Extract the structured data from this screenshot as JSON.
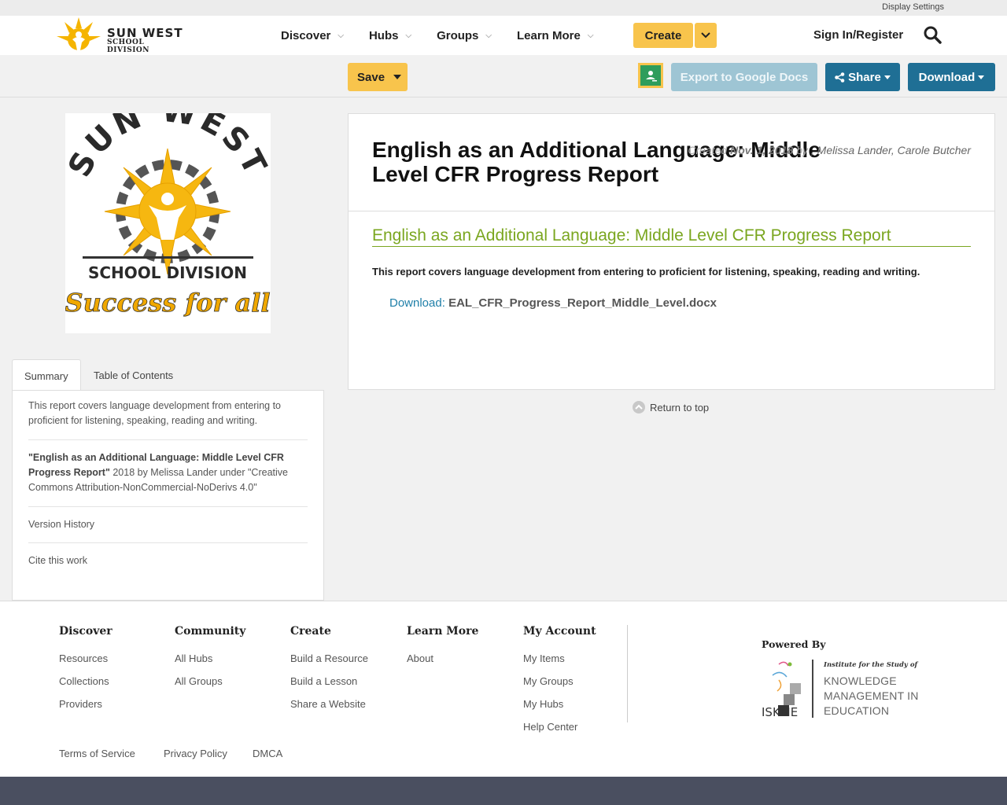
{
  "topbar": {
    "display_settings": "Display Settings"
  },
  "logo": {
    "line1": "SUN WEST",
    "line2": "SCHOOL DIVISION"
  },
  "nav": {
    "items": [
      {
        "label": "Discover"
      },
      {
        "label": "Hubs"
      },
      {
        "label": "Groups"
      },
      {
        "label": "Learn More"
      }
    ],
    "create_label": "Create",
    "signin_label": "Sign In/Register"
  },
  "toolbar": {
    "save_label": "Save",
    "export_label": "Export to Google Docs",
    "share_label": "Share",
    "download_label": "Download"
  },
  "cover": {
    "arc_text": "SUN WEST",
    "division": "SCHOOL DIVISION",
    "motto": "Success for all"
  },
  "tabs": {
    "summary": "Summary",
    "toc": "Table of Contents"
  },
  "summary": {
    "text": "This report covers language development from entering to proficient for listening, speaking, reading and writing.",
    "attribution_title": "\"English as an Additional Language: Middle Level CFR Progress Report\"",
    "attribution_mid": " 2018 by Melissa Lander under ",
    "license": "\"Creative Commons Attribution-NonCommercial-NoDerivs 4.0\"",
    "version_history": "Version History",
    "cite": "Cite this work"
  },
  "resource": {
    "title": "English as an Additional Language: Middle Level CFR Progress Report",
    "meta_created": "Created ",
    "meta_date": "Nov. 1, 2018",
    "meta_by": " by , ",
    "meta_authors": "Melissa Lander, Carole Butcher",
    "link_title": "English as an Additional Language: Middle Level CFR Progress Report",
    "description": "This report covers language development from entering to proficient for listening, speaking, reading and writing.",
    "download_label": "Download:",
    "download_file": "EAL_CFR_Progress_Report_Middle_Level.docx",
    "return_top": "Return to top"
  },
  "footer": {
    "columns": [
      {
        "heading": "Discover",
        "links": [
          "Resources",
          "Collections",
          "Providers"
        ]
      },
      {
        "heading": "Community",
        "links": [
          "All Hubs",
          "All Groups"
        ]
      },
      {
        "heading": "Create",
        "links": [
          "Build a Resource",
          "Build a Lesson",
          "Share a Website"
        ]
      },
      {
        "heading": "Learn More",
        "links": [
          "About"
        ]
      },
      {
        "heading": "My Account",
        "links": [
          "My Items",
          "My Groups",
          "My Hubs",
          "Help Center"
        ]
      }
    ],
    "powered_by": "Powered By",
    "iskme_inst": "Institute for the Study of",
    "iskme_km1": "KNOWLEDGE",
    "iskme_km2": "MANAGEMENT IN",
    "iskme_km3": "EDUCATION",
    "iskme_mark": "ISKME",
    "legal": [
      "Terms of Service",
      "Privacy Policy",
      "DMCA"
    ]
  },
  "colors": {
    "accent_yellow": "#f8c44c",
    "primary_blue": "#1f6f95",
    "export_disabled": "#9ec5d4",
    "link_green": "#7aa61f",
    "bottom_bar": "#4a4f60"
  }
}
